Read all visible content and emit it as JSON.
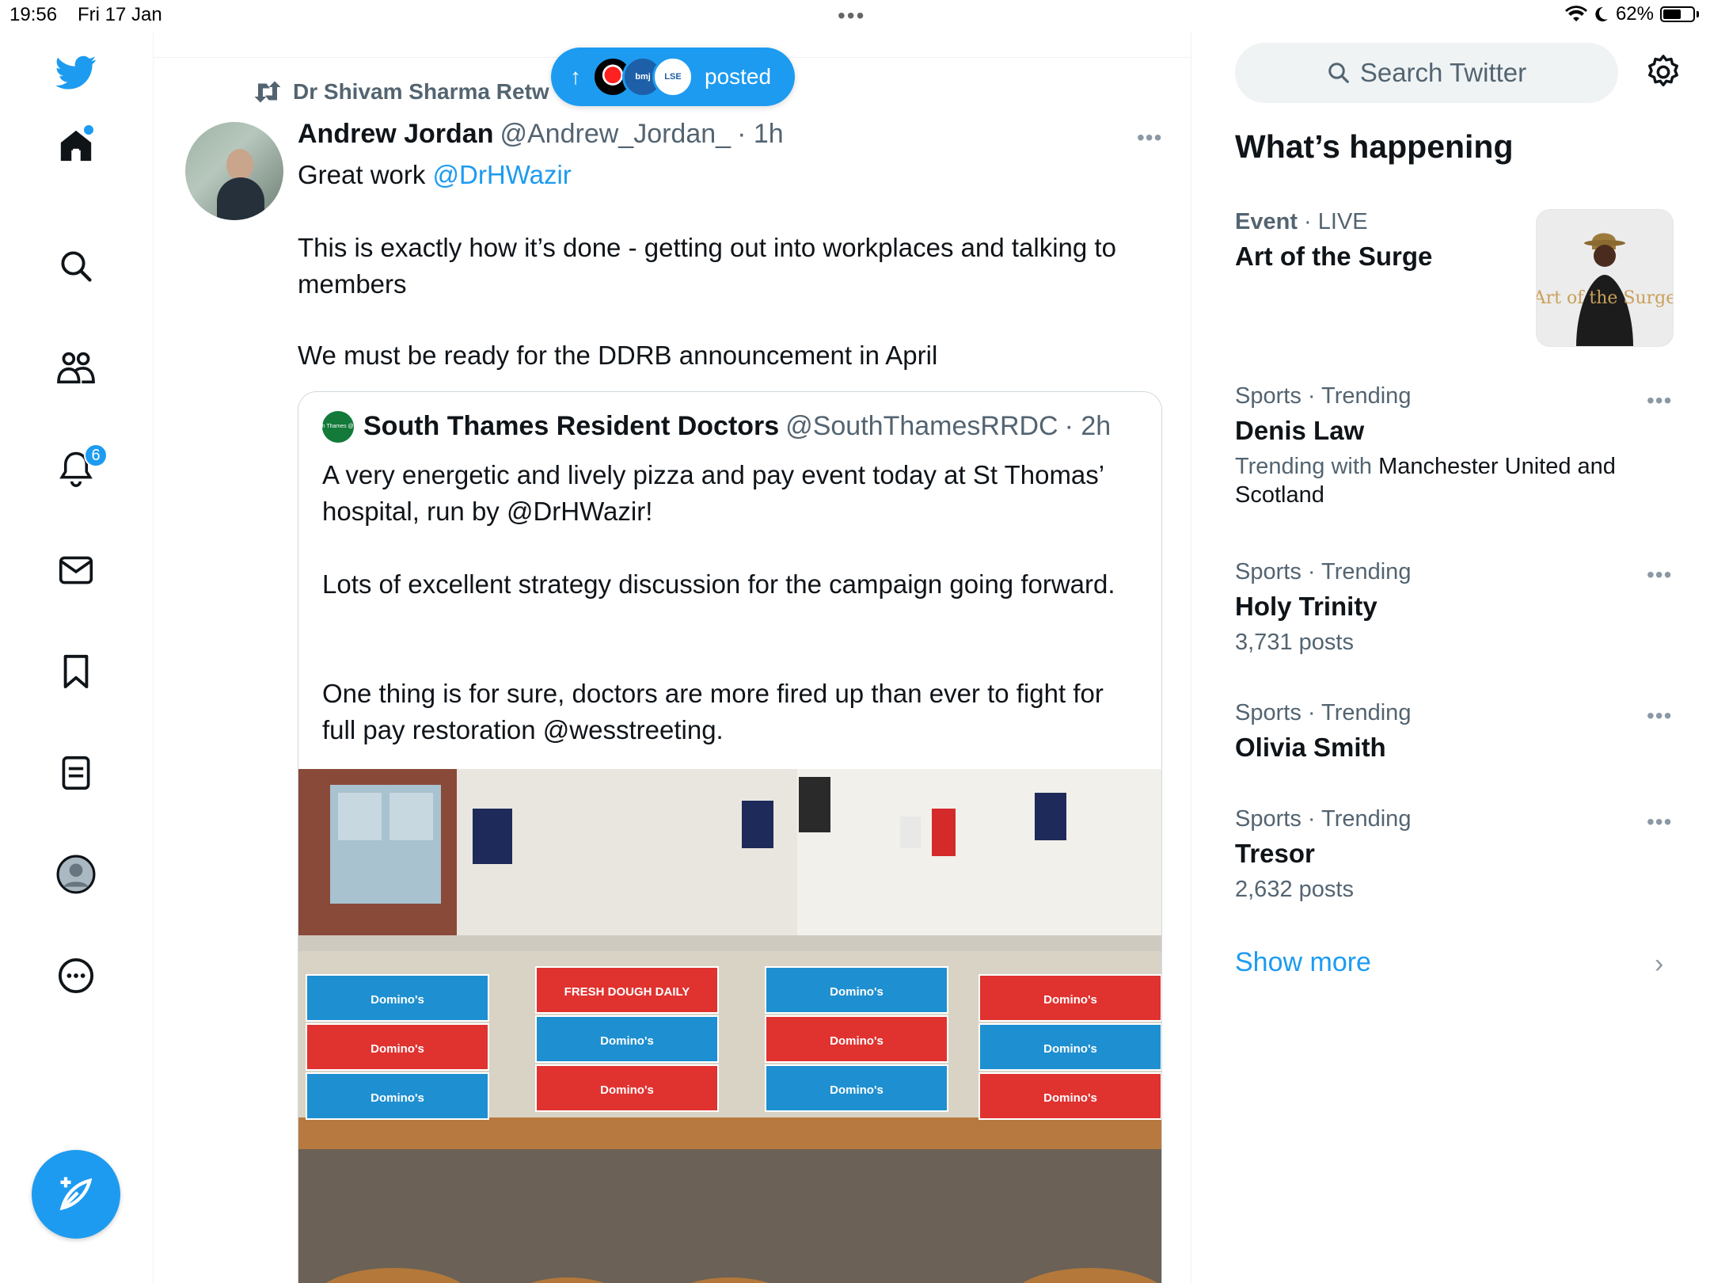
{
  "status_bar": {
    "time": "19:56",
    "date": "Fri 17 Jan",
    "battery": "62%",
    "battery_level": 0.62
  },
  "nav": {
    "notifications_badge": "6",
    "icons": [
      "twitter-logo-icon",
      "home-icon",
      "search-icon",
      "communities-icon",
      "notifications-icon",
      "messages-icon",
      "bookmarks-icon",
      "lists-icon",
      "profile-icon",
      "more-icon",
      "compose-icon"
    ]
  },
  "feed": {
    "new_posts_pill": {
      "label": "posted",
      "avatars": [
        "",
        "bmj",
        "LSE"
      ]
    },
    "retweet_label": "Dr Shivam Sharma Retw",
    "tweet": {
      "name": "Andrew Jordan",
      "handle": "@Andrew_Jordan_",
      "time": "· 1h",
      "line1_prefix": "Great work ",
      "line1_mention": "@DrHWazir",
      "para2": "This is exactly how it’s done - getting out into workplaces and talking to members",
      "para3": "We must be ready for the DDRB announcement in April"
    },
    "quote": {
      "avatar_text": "South Thames @BMA",
      "name": "South Thames Resident Doctors",
      "handle": "@SouthThamesRRDC",
      "time": "· 2h",
      "para1": "A very energetic and lively pizza and pay event today at St Thomas’ hospital, run by @DrHWazir!",
      "para2": "Lots of excellent strategy discussion for the campaign going forward.",
      "para3": "One thing is for sure, doctors are more fired up than ever to fight for full pay restoration @wesstreeting.",
      "image_boxes": [
        "Domino's",
        "Domino's",
        "Domino's",
        "FRESH DOUGH DAILY",
        "Domino's",
        "Domino's",
        "Domino's",
        "Domino's",
        "Domino's",
        "Domino's",
        "Domino's",
        "Domino's"
      ]
    }
  },
  "sidebar": {
    "search_placeholder": "Search Twitter",
    "title": "What’s happening",
    "trends": [
      {
        "category": "Event",
        "context": " · LIVE",
        "name": "Art of the Surge",
        "sub": "",
        "thumb_text": "Art of the Surge"
      },
      {
        "category": "Sports · Trending",
        "context": "",
        "name": "Denis Law",
        "sub_prefix": "Trending with ",
        "sub": "Manchester United and Scotland"
      },
      {
        "category": "Sports · Trending",
        "context": "",
        "name": "Holy Trinity",
        "sub": "3,731 posts"
      },
      {
        "category": "Sports · Trending",
        "context": "",
        "name": "Olivia Smith",
        "sub": ""
      },
      {
        "category": "Sports · Trending",
        "context": "",
        "name": "Tresor",
        "sub": "2,632 posts"
      }
    ],
    "show_more": "Show more"
  },
  "colors": {
    "accent": "#1d9bf0",
    "text": "#0f1419",
    "secondary": "#536471",
    "border": "#eff3f4"
  }
}
